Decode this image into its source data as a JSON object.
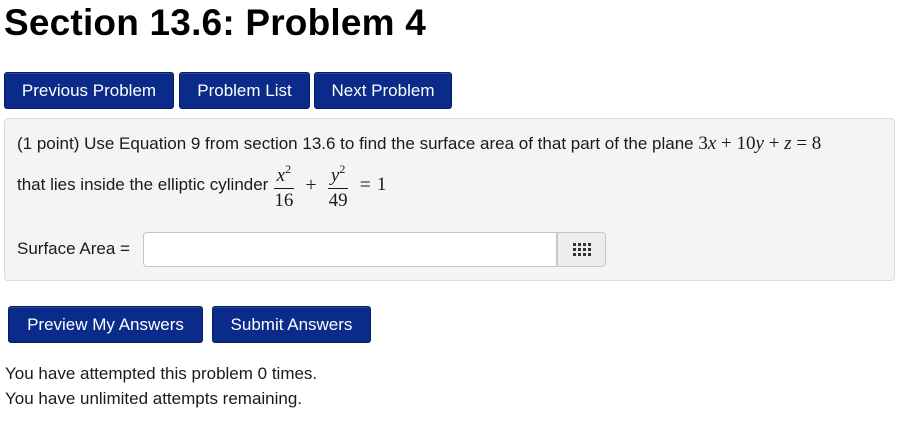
{
  "page": {
    "title": "Section 13.6: Problem 4"
  },
  "nav": {
    "prev_label": "Previous Problem",
    "list_label": "Problem List",
    "next_label": "Next Problem"
  },
  "problem": {
    "intro_text": "(1 point) Use Equation 9 from section 13.6 to find the surface area of that part of the plane ",
    "plane_eq": {
      "c1": "3",
      "v1": "x",
      "op1": "+",
      "c2": "10",
      "v2": "y",
      "op2": "+",
      "v3": "z",
      "eq": "=",
      "rhs": "8"
    },
    "cylinder_text": "that lies inside the elliptic cylinder ",
    "cyl_eq": {
      "num1_var": "x",
      "num1_exp": "2",
      "den1": "16",
      "plus": "+",
      "num2_var": "y",
      "num2_exp": "2",
      "den2": "49",
      "eq": "=",
      "rhs": "1"
    },
    "answer_label": "Surface Area =",
    "answer_value": "",
    "keypad_icon": "keypad-grid-icon"
  },
  "actions": {
    "preview_label": "Preview My Answers",
    "submit_label": "Submit Answers"
  },
  "status": {
    "attempts_text": "You have attempted this problem 0 times.",
    "remaining_text": "You have unlimited attempts remaining."
  },
  "colors": {
    "button_bg": "#0a2b8a",
    "button_text": "#ffffff",
    "panel_bg": "#f4f4f4"
  }
}
